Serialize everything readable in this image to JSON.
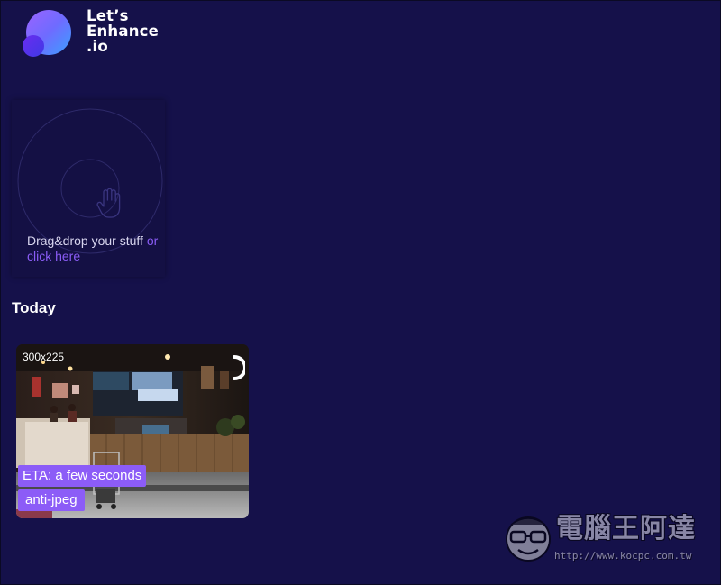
{
  "brand": {
    "name": "Let’s\nEnhance\n.io",
    "colors": {
      "background": "#15114a",
      "accent": "#8c5cf7",
      "logo_gradient_start": "#9b63ff",
      "logo_gradient_end": "#3ba0ff"
    }
  },
  "upload": {
    "text": "Drag&drop your stuff ",
    "link_label": "or click here",
    "icon": "hand-pointer-icon"
  },
  "history": {
    "section_title": "Today",
    "items": [
      {
        "dimensions": "300x225",
        "eta": "ETA: a few seconds",
        "filter": "anti-jpeg",
        "status": "processing",
        "status_icon": "loading-spinner-icon"
      }
    ]
  },
  "watermark": {
    "title": "電腦王阿達",
    "url": "http://www.kocpc.com.tw"
  }
}
